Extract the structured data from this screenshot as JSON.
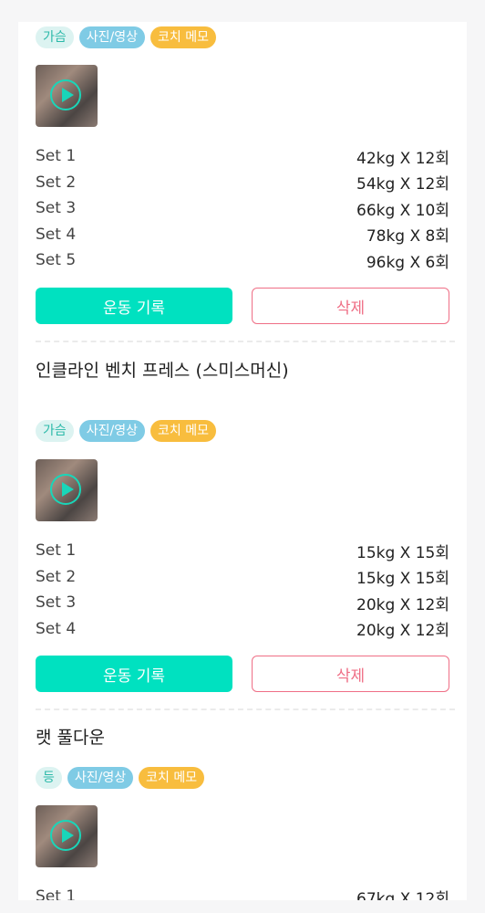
{
  "exercises": [
    {
      "title": "",
      "tags": {
        "muscle": "가슴",
        "media": "사진/영상",
        "memo": "코치 메모"
      },
      "sets": [
        {
          "label": "Set 1",
          "value": "42kg X 12회"
        },
        {
          "label": "Set 2",
          "value": "54kg X 12회"
        },
        {
          "label": "Set 3",
          "value": "66kg X 10회"
        },
        {
          "label": "Set 4",
          "value": "78kg X 8회"
        },
        {
          "label": "Set 5",
          "value": "96kg X 6회"
        }
      ],
      "record_label": "운동 기록",
      "delete_label": "삭제"
    },
    {
      "title": "인클라인 벤치 프레스 (스미스머신)",
      "tags": {
        "muscle": "가슴",
        "media": "사진/영상",
        "memo": "코치 메모"
      },
      "sets": [
        {
          "label": "Set 1",
          "value": "15kg X 15회"
        },
        {
          "label": "Set 2",
          "value": "15kg X 15회"
        },
        {
          "label": "Set 3",
          "value": "20kg X 12회"
        },
        {
          "label": "Set 4",
          "value": "20kg X 12회"
        }
      ],
      "record_label": "운동 기록",
      "delete_label": "삭제"
    },
    {
      "title": "랫 풀다운",
      "tags": {
        "muscle": "등",
        "media": "사진/영상",
        "memo": "코치 메모"
      },
      "sets": [
        {
          "label": "Set 1",
          "value": "67kg X 12회"
        }
      ],
      "record_label": "",
      "delete_label": ""
    }
  ],
  "icons": {
    "video_thumbnail": "play-icon"
  },
  "colors": {
    "accent": "#00e1c0",
    "delete": "#ef6f86",
    "media_tag": "#7fcbe5",
    "memo_tag": "#f8bd3e",
    "muscle_tag_bg": "#dcf3f1"
  }
}
